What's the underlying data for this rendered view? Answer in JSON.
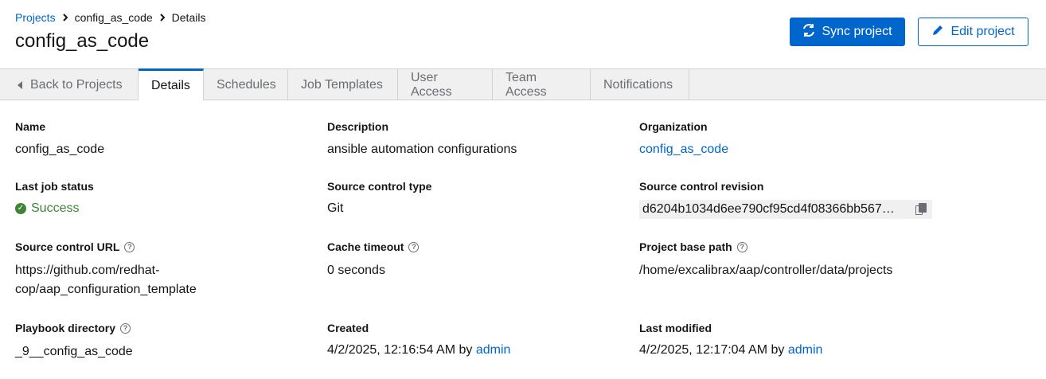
{
  "breadcrumb": {
    "items": [
      "Projects",
      "config_as_code",
      "Details"
    ]
  },
  "page_title": "config_as_code",
  "actions": {
    "sync_label": "Sync project",
    "edit_label": "Edit project"
  },
  "tabs": [
    {
      "label": "Back to Projects"
    },
    {
      "label": "Details"
    },
    {
      "label": "Schedules"
    },
    {
      "label": "Job Templates"
    },
    {
      "label": "User Access"
    },
    {
      "label": "Team Access"
    },
    {
      "label": "Notifications"
    }
  ],
  "details": {
    "name": {
      "label": "Name",
      "value": "config_as_code"
    },
    "description": {
      "label": "Description",
      "value": "ansible automation configurations"
    },
    "organization": {
      "label": "Organization",
      "value": "config_as_code"
    },
    "last_job_status": {
      "label": "Last job status",
      "value": "Success"
    },
    "scm_type": {
      "label": "Source control type",
      "value": "Git"
    },
    "scm_revision": {
      "label": "Source control revision",
      "value": "d6204b1034d6ee790cf95cd4f08366bb567…"
    },
    "scm_url": {
      "label": "Source control URL",
      "value_line1": "https://github.com/redhat-",
      "value_line2": "cop/aap_configuration_template"
    },
    "cache_timeout": {
      "label": "Cache timeout",
      "value": "0 seconds"
    },
    "base_path": {
      "label": "Project base path",
      "value": "/home/excalibrax/aap/controller/data/projects"
    },
    "playbook_dir": {
      "label": "Playbook directory",
      "value": "_9__config_as_code"
    },
    "created": {
      "label": "Created",
      "value": "4/2/2025, 12:16:54 AM by ",
      "user": "admin"
    },
    "modified": {
      "label": "Last modified",
      "value": "4/2/2025, 12:17:04 AM by ",
      "user": "admin"
    }
  },
  "colors": {
    "accent": "#0066cc",
    "success": "#3e8635"
  }
}
